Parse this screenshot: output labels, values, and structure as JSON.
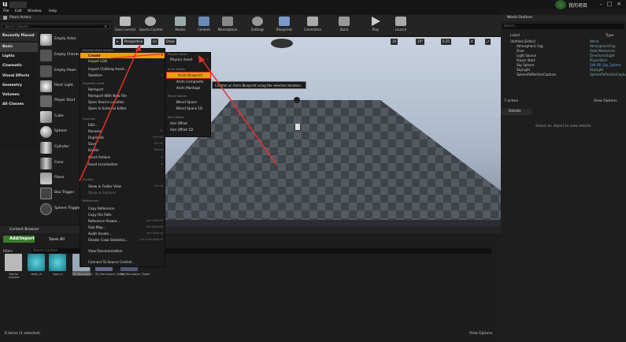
{
  "window": {
    "project_tab": "我的项目",
    "menu": [
      "File",
      "Edit",
      "Window",
      "Help"
    ]
  },
  "place_actors": {
    "tab_label": "Place Actors",
    "search_placeholder": "Search Classes",
    "categories": [
      "Recently Placed",
      "Basic",
      "Lights",
      "Cinematic",
      "Visual Effects",
      "Geometry",
      "Volumes",
      "All Classes"
    ],
    "actors": [
      "Empty Actor",
      "Empty Character",
      "Empty Pawn",
      "Point Light",
      "Player Start",
      "Cube",
      "Sphere",
      "Cylinder",
      "Cone",
      "Plane",
      "Box Trigger",
      "Sphere Trigger"
    ]
  },
  "toolbar": {
    "buttons": [
      "Save Current",
      "Source Control",
      "Modes",
      "Content",
      "Marketplace",
      "Settings",
      "Blueprints",
      "Cinematics",
      "Build",
      "Play",
      "Launch"
    ]
  },
  "viewport": {
    "perspective": "Perspective",
    "lit": "Lit",
    "show": "Show",
    "grid_snap": "10",
    "rot_snap": "10°",
    "scale_snap": "0.25",
    "cam_speed": "4"
  },
  "world_outliner": {
    "tab_label": "World Outliner",
    "search_placeholder": "Search...",
    "col_label": "Label",
    "col_type": "Type",
    "rows": [
      {
        "label": "Untitled (Editor)",
        "type": "World"
      },
      {
        "label": "Atmospheric Fog",
        "type": "AtmosphericFog"
      },
      {
        "label": "Floor",
        "type": "StaticMeshActor"
      },
      {
        "label": "Light Source",
        "type": "DirectionalLight"
      },
      {
        "label": "Player Start",
        "type": "PlayerStart"
      },
      {
        "label": "Sky Sphere",
        "type": "Edit BP_Sky_Sphere"
      },
      {
        "label": "SkyLight",
        "type": "SkyLight"
      },
      {
        "label": "SphereReflectionCapture",
        "type": "SphereReflectionCapture"
      }
    ],
    "count": "7 actors",
    "view_options": "View Options"
  },
  "details": {
    "tab_label": "Details",
    "empty_text": "Select an object to view details."
  },
  "content_browser": {
    "tab_label": "Content Browser",
    "add_import": "Add/Import",
    "save_all": "Save All",
    "filters": "Filters",
    "search_placeholder": "Search Content",
    "assets": [
      "Starter Content",
      "body_m",
      "logo_m",
      "SK_Mannequin",
      "SK_Mannequin_Tower",
      "SK_Mannequin_Tower"
    ],
    "status": "6 items (1 selected)",
    "view_options": "View Options"
  },
  "context_menu": {
    "header": "Skeletal Mesh Actions",
    "items": [
      {
        "label": "Create",
        "key": ""
      },
      {
        "label": "Import LOD",
        "key": ""
      },
      {
        "label": "Import Clothing Asset...",
        "key": ""
      },
      {
        "label": "Skeleton",
        "key": ""
      },
      {
        "label": "Reimport",
        "key": ""
      },
      {
        "label": "Reimport With New File",
        "key": ""
      },
      {
        "label": "Open Source Location",
        "key": ""
      },
      {
        "label": "Open In External Editor",
        "key": ""
      },
      {
        "label": "Edit...",
        "key": ""
      },
      {
        "label": "Rename",
        "key": "F2"
      },
      {
        "label": "Duplicate",
        "key": "Ctrl+W"
      },
      {
        "label": "Save",
        "key": "Ctrl+S"
      },
      {
        "label": "Delete",
        "key": "Delete"
      },
      {
        "label": "Asset Actions",
        "key": ""
      },
      {
        "label": "Asset Localization",
        "key": ""
      },
      {
        "label": "Show in Folder View",
        "key": "Ctrl+B"
      },
      {
        "label": "Show in Explorer",
        "key": ""
      },
      {
        "label": "Copy Reference",
        "key": ""
      },
      {
        "label": "Copy File Path",
        "key": ""
      },
      {
        "label": "Reference Viewer...",
        "key": "Alt+Shift+R"
      },
      {
        "label": "Size Map...",
        "key": "Alt+Shift+M"
      },
      {
        "label": "Audit Assets...",
        "key": "Alt+Shift+A"
      },
      {
        "label": "Shader Cook Statistics...",
        "key": "Ctrl+Alt+Shift+S"
      },
      {
        "label": "View Documentation",
        "key": ""
      },
      {
        "label": "Connect To Source Control...",
        "key": ""
      }
    ],
    "sections": [
      "Imported Asset",
      "Common",
      "Explore",
      "References"
    ]
  },
  "create_submenu": {
    "items": [
      "Physics Asset",
      "Anim Blueprint",
      "Anim Composite",
      "Anim Montage",
      "Blend Space",
      "Blend Space 1D",
      "Aim Offset",
      "Aim Offset 1D"
    ],
    "sections": [
      "Physics Asset",
      "Anim Assets",
      "Blend Spaces",
      "Aim Offsets"
    ],
    "tooltip": "Creates an Anim Blueprint using the selected skeleton."
  },
  "colors": {
    "accent": "#e8a012",
    "arrow": "#e8312a",
    "highlight_box": "#e02020"
  }
}
